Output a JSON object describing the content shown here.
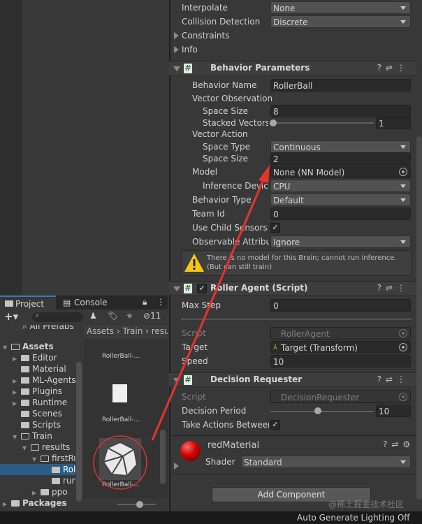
{
  "inspector": {
    "rigidbody": {
      "interpolate_label": "Interpolate",
      "interpolate_value": "None",
      "collision_label": "Collision Detection",
      "collision_value": "Discrete",
      "constraints": "Constraints",
      "info": "Info"
    },
    "behavior_parameters": {
      "title": "Behavior Parameters",
      "behavior_name_label": "Behavior Name",
      "behavior_name": "RollerBall",
      "vector_observation": "Vector Observation",
      "space_size_label": "Space Size",
      "obs_space_size": "8",
      "stacked_label": "Stacked Vectors",
      "stacked_value": "1",
      "stacked_fraction": 0.0,
      "vector_action": "Vector Action",
      "space_type_label": "Space Type",
      "space_type": "Continuous",
      "action_space_size": "2",
      "model_label": "Model",
      "model_value": "None (NN Model)",
      "inference_label": "Inference Device",
      "inference_value": "CPU",
      "behavior_type_label": "Behavior Type",
      "behavior_type": "Default",
      "team_id_label": "Team Id",
      "team_id": "0",
      "use_child_label": "Use Child Sensors",
      "use_child": true,
      "observable_label": "Observable Attribute Handling",
      "observable_value": "Ignore",
      "warning": "There is no model for this Brain; cannot run inference. (But can still train)"
    },
    "roller_agent": {
      "title": "Roller Agent (Script)",
      "enabled": true,
      "max_step_label": "Max Step",
      "max_step": "0",
      "script_label": "Script",
      "script_value": "RollerAgent",
      "target_label": "Target",
      "target_value": "Target (Transform)",
      "speed_label": "Speed",
      "speed": "10"
    },
    "decision_requester": {
      "title": "Decision Requester",
      "script_label": "Script",
      "script_value": "DecisionRequester",
      "period_label": "Decision Period",
      "period": "10",
      "period_fraction": 0.45,
      "take_actions_label": "Take Actions Between Decisions",
      "take_actions": true
    },
    "material": {
      "name": "redMaterial",
      "shader_label": "Shader",
      "shader": "Standard"
    },
    "add_component": "Add Component"
  },
  "project": {
    "tabs": [
      "Project",
      "Console"
    ],
    "hidden_count": "11",
    "tree": [
      "All Prefabs",
      "Assets",
      "Editor",
      "Material",
      "ML-Agents",
      "Plugins",
      "Runtime",
      "Scenes",
      "Scripts",
      "Train",
      "results",
      "firstRun",
      "RollerBall",
      "run_logs",
      "ppo",
      "Packages"
    ],
    "breadcrumb": [
      "Assets",
      "Train",
      "results"
    ],
    "assets": [
      "RollerBall-...",
      "RollerBall-...",
      "RollerBall-..."
    ]
  },
  "status": "Auto Generate Lighting Off",
  "watermark": "@稀土掘金技术社区",
  "colors": {
    "accent": "#2c5d87",
    "annotation": "#e8322e",
    "warning": "#f5c518"
  }
}
